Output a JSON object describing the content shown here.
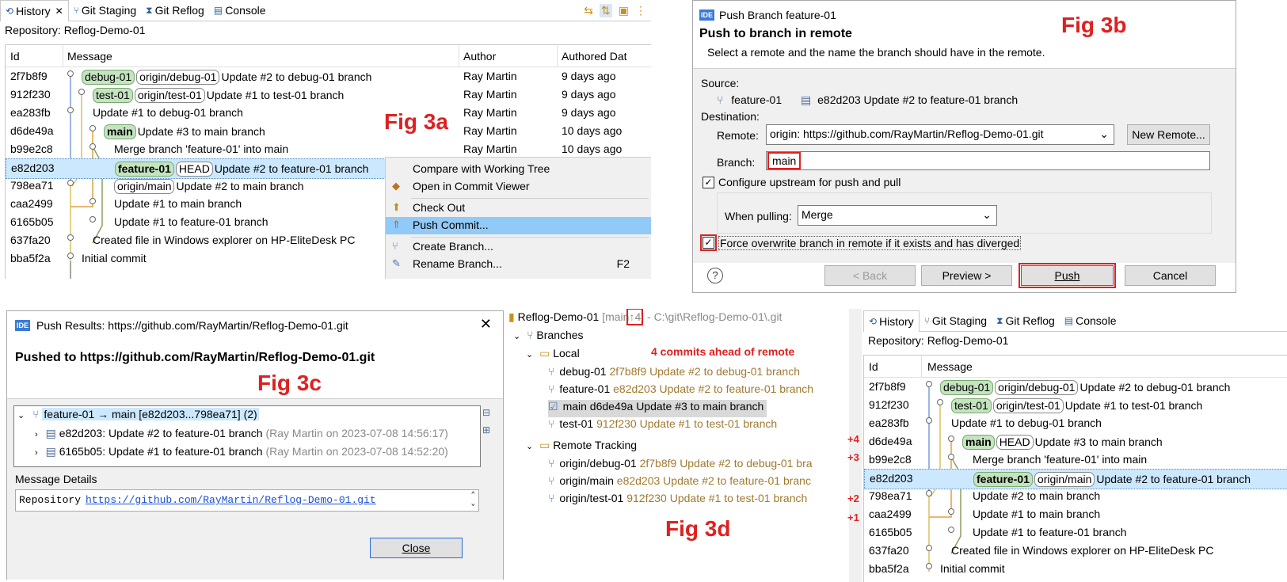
{
  "fig_labels": {
    "a": "Fig 3a",
    "b": "Fig 3b",
    "c": "Fig 3c",
    "d": "Fig 3d"
  },
  "colors": {
    "accent_red": "#e02020",
    "selection": "#cce8ff",
    "local_branch": "#c4e3bf",
    "menu_highlight": "#91c9f7"
  },
  "history_a": {
    "tabs": [
      {
        "label": "History",
        "icon": "history-icon"
      },
      {
        "label": "Git Staging",
        "icon": "staging-icon"
      },
      {
        "label": "Git Reflog",
        "icon": "reflog-icon"
      },
      {
        "label": "Console",
        "icon": "console-icon"
      }
    ],
    "repository": "Repository: Reflog-Demo-01",
    "columns": {
      "id": "Id",
      "message": "Message",
      "author": "Author",
      "date": "Authored Dat"
    },
    "rows": [
      {
        "id": "2f7b8f9",
        "refs": [
          "debug-01",
          "origin/debug-01"
        ],
        "message": "Update #2 to debug-01 branch",
        "author": "Ray Martin",
        "date": "9 days ago"
      },
      {
        "id": "912f230",
        "refs": [
          "test-01",
          "origin/test-01"
        ],
        "message": "Update #1 to test-01 branch",
        "author": "Ray Martin",
        "date": "9 days ago"
      },
      {
        "id": "ea283fb",
        "refs": [],
        "message": "Update #1 to debug-01 branch",
        "author": "Ray Martin",
        "date": "9 days ago"
      },
      {
        "id": "d6de49a",
        "refs": [
          "main"
        ],
        "message": "Update #3 to main branch",
        "author": "Ray Martin",
        "date": "10 days ago"
      },
      {
        "id": "b99e2c8",
        "refs": [],
        "message": "Merge branch 'feature-01' into main",
        "author": "Ray Martin",
        "date": "10 days ago"
      },
      {
        "id": "e82d203",
        "refs": [
          "feature-01",
          "HEAD"
        ],
        "message": "Update #2 to feature-01 branch",
        "author": "",
        "date": ""
      },
      {
        "id": "798ea71",
        "refs": [
          "origin/main"
        ],
        "message": "Update #2 to main branch",
        "author": "",
        "date": ""
      },
      {
        "id": "caa2499",
        "refs": [],
        "message": "Update #1 to main branch",
        "author": "",
        "date": ""
      },
      {
        "id": "6165b05",
        "refs": [],
        "message": "Update #1 to feature-01 branch",
        "author": "",
        "date": ""
      },
      {
        "id": "637fa20",
        "refs": [],
        "message": "Created file in Windows explorer on HP-EliteDesk PC",
        "author": "",
        "date": ""
      },
      {
        "id": "bba5f2a",
        "refs": [],
        "message": "Initial commit",
        "author": "",
        "date": ""
      }
    ]
  },
  "context_menu": {
    "items": [
      {
        "label": "Compare with Working Tree",
        "shortcut": ""
      },
      {
        "label": "Open in Commit Viewer",
        "shortcut": ""
      },
      {
        "label": "Check Out",
        "shortcut": ""
      },
      {
        "label": "Push Commit...",
        "shortcut": ""
      },
      {
        "label": "Create Branch...",
        "shortcut": ""
      },
      {
        "label": "Rename Branch...",
        "shortcut": "F2"
      }
    ]
  },
  "push_dialog": {
    "window_title": "Push Branch feature-01",
    "heading": "Push to branch in remote",
    "subtitle": "Select a remote and the name the branch should have in the remote.",
    "source_label": "Source:",
    "source_branch": "feature-01",
    "source_commit": "e82d203  Update #2 to feature-01 branch",
    "destination_label": "Destination:",
    "remote_label": "Remote:",
    "remote_value": "origin: https://github.com/RayMartin/Reflog-Demo-01.git",
    "new_remote_button": "New Remote...",
    "branch_label": "Branch:",
    "branch_value": "main",
    "configure_upstream": "Configure upstream for push and pull",
    "when_pulling_label": "When pulling:",
    "when_pulling_value": "Merge",
    "force_overwrite": "Force overwrite branch in remote if it exists and has diverged",
    "back_button": "< Back",
    "preview_button": "Preview >",
    "push_button": "Push",
    "cancel_button": "Cancel"
  },
  "push_results": {
    "window_title": "Push Results: https://github.com/RayMartin/Reflog-Demo-01.git",
    "heading": "Pushed to https://github.com/RayMartin/Reflog-Demo-01.git",
    "tree_root": "feature-01 → main [e82d203...798ea71] (2)",
    "commits": [
      {
        "text": "e82d203: Update #2 to feature-01 branch",
        "meta": "(Ray Martin on 2023-07-08 14:56:17)"
      },
      {
        "text": "6165b05: Update #1 to feature-01 branch",
        "meta": "(Ray Martin on 2023-07-08 14:52:20)"
      }
    ],
    "details_label": "Message Details",
    "details_prefix": "Repository",
    "details_link": "https://github.com/RayMartin/Reflog-Demo-01.git",
    "close_button": "Close"
  },
  "repo_tree": {
    "repo_name": "Reflog-Demo-01",
    "repo_branch": "main",
    "repo_ahead": "↑4",
    "repo_path": "- C:\\git\\Reflog-Demo-01\\.git",
    "annotation": "4 commits ahead of remote",
    "branches_label": "Branches",
    "local_label": "Local",
    "local": [
      {
        "name": "debug-01",
        "detail": "2f7b8f9 Update #2 to debug-01 branch",
        "current": false
      },
      {
        "name": "feature-01",
        "detail": "e82d203 Update #2 to feature-01 branch",
        "current": false
      },
      {
        "name": "main",
        "detail": "d6de49a Update #3 to main branch",
        "current": true
      },
      {
        "name": "test-01",
        "detail": "912f230 Update #1 to test-01 branch",
        "current": false
      }
    ],
    "remote_label": "Remote Tracking",
    "remote": [
      {
        "name": "origin/debug-01",
        "detail": "2f7b8f9 Update #2 to debug-01 bra"
      },
      {
        "name": "origin/main",
        "detail": "e82d203 Update #2 to feature-01 branc"
      },
      {
        "name": "origin/test-01",
        "detail": "912f230 Update #1 to test-01 branch"
      }
    ]
  },
  "history_d": {
    "tabs": [
      {
        "label": "History",
        "icon": "history-icon"
      },
      {
        "label": "Git Staging",
        "icon": "staging-icon"
      },
      {
        "label": "Git Reflog",
        "icon": "reflog-icon"
      },
      {
        "label": "Console",
        "icon": "console-icon"
      }
    ],
    "repository": "Repository: Reflog-Demo-01",
    "columns": {
      "id": "Id",
      "message": "Message"
    },
    "ahead_markers": [
      "+4",
      "+3",
      "+2",
      "+1"
    ],
    "rows": [
      {
        "id": "2f7b8f9",
        "refs": [
          "debug-01",
          "origin/debug-01"
        ],
        "message": "Update #2 to debug-01 branch"
      },
      {
        "id": "912f230",
        "refs": [
          "test-01",
          "origin/test-01"
        ],
        "message": "Update #1 to test-01 branch"
      },
      {
        "id": "ea283fb",
        "refs": [],
        "message": "Update #1 to debug-01 branch"
      },
      {
        "id": "d6de49a",
        "refs": [
          "main",
          "HEAD"
        ],
        "message": "Update #3 to main branch"
      },
      {
        "id": "b99e2c8",
        "refs": [],
        "message": "Merge branch 'feature-01' into main"
      },
      {
        "id": "e82d203",
        "refs": [
          "feature-01",
          "origin/main"
        ],
        "message": "Update #2 to feature-01 branch"
      },
      {
        "id": "798ea71",
        "refs": [],
        "message": "Update #2 to main branch"
      },
      {
        "id": "caa2499",
        "refs": [],
        "message": "Update #1 to main branch"
      },
      {
        "id": "6165b05",
        "refs": [],
        "message": "Update #1 to feature-01 branch"
      },
      {
        "id": "637fa20",
        "refs": [],
        "message": "Created file in Windows explorer on HP-EliteDesk PC"
      },
      {
        "id": "bba5f2a",
        "refs": [],
        "message": "Initial commit"
      }
    ]
  }
}
